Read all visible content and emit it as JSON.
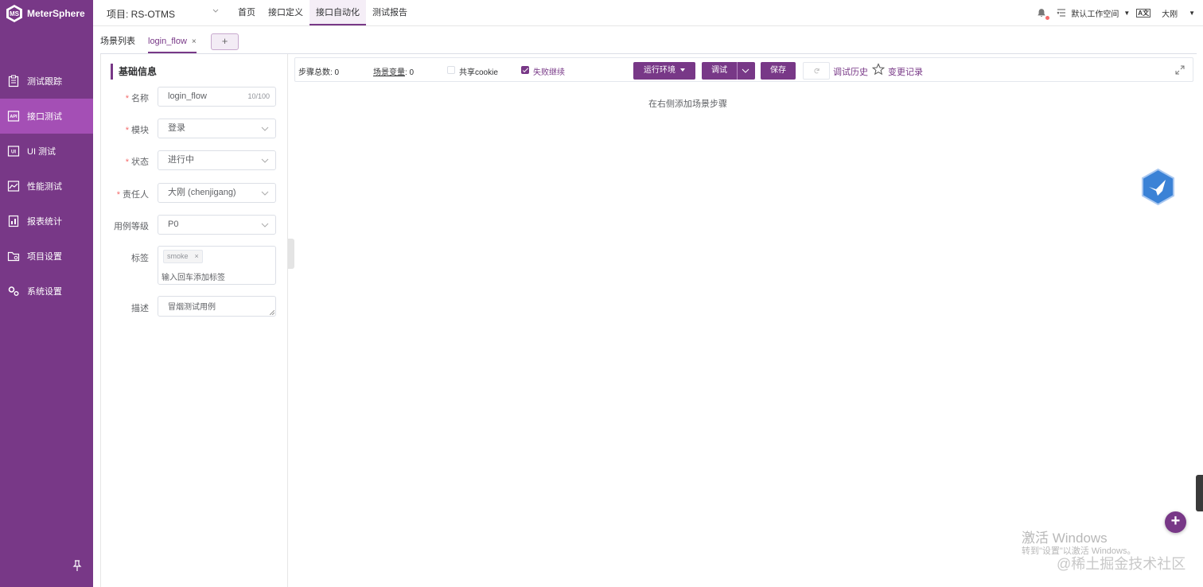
{
  "app": {
    "name": "MeterSphere"
  },
  "sidebar": {
    "items": [
      {
        "label": "测试跟踪",
        "icon": "clipboard-icon"
      },
      {
        "label": "接口测试",
        "icon": "api-icon",
        "active": true
      },
      {
        "label": "UI 测试",
        "icon": "ui-icon"
      },
      {
        "label": "性能测试",
        "icon": "chart-icon"
      },
      {
        "label": "报表统计",
        "icon": "report-icon"
      },
      {
        "label": "项目设置",
        "icon": "folder-settings-icon"
      },
      {
        "label": "系统设置",
        "icon": "gears-icon"
      }
    ]
  },
  "header": {
    "project": "项目: RS-OTMS",
    "menu": [
      "首页",
      "接口定义",
      "接口自动化",
      "测试报告"
    ],
    "active_menu": "接口自动化",
    "workspace": "默认工作空间",
    "lang_badge": "A文",
    "user": "大刚"
  },
  "tabs": {
    "list_label": "场景列表",
    "current": "login_flow",
    "close": "×",
    "add": "+"
  },
  "form": {
    "section_title": "基础信息",
    "name_label": "名称",
    "name_value": "login_flow",
    "name_count": "10/100",
    "module_label": "模块",
    "module_value": "登录",
    "status_label": "状态",
    "status_value": "进行中",
    "owner_label": "责任人",
    "owner_value": "大刚 (chenjigang)",
    "level_label": "用例等级",
    "level_value": "P0",
    "tags_label": "标签",
    "tag": "smoke",
    "tag_close": "×",
    "tags_placeholder": "输入回车添加标签",
    "desc_label": "描述",
    "desc_value": "冒烟测试用例",
    "required_mark": "*"
  },
  "toolbar": {
    "steps_total_label": "步骤总数",
    "steps_total": ": 0",
    "scene_vars_label": "场景变量",
    "scene_vars": ": 0",
    "share_cookie": "共享cookie",
    "share_cookie_checked": false,
    "continue_on_fail": "失败继续",
    "continue_on_fail_checked": true,
    "env_button": "运行环境",
    "debug_button": "调试",
    "save_button": "保存",
    "debug_history": "调试历史",
    "change_log": "变更记录"
  },
  "main": {
    "empty_hint": "在右侧添加场景步骤"
  },
  "fab_label": "+",
  "watermark": {
    "line1": "激活 Windows",
    "line2": "转到\"设置\"以激活 Windows。",
    "line3": "@稀土掘金技术社区"
  },
  "colors": {
    "brand": "#783887",
    "brand_active": "#a44fb5",
    "required": "#f56c6c"
  }
}
